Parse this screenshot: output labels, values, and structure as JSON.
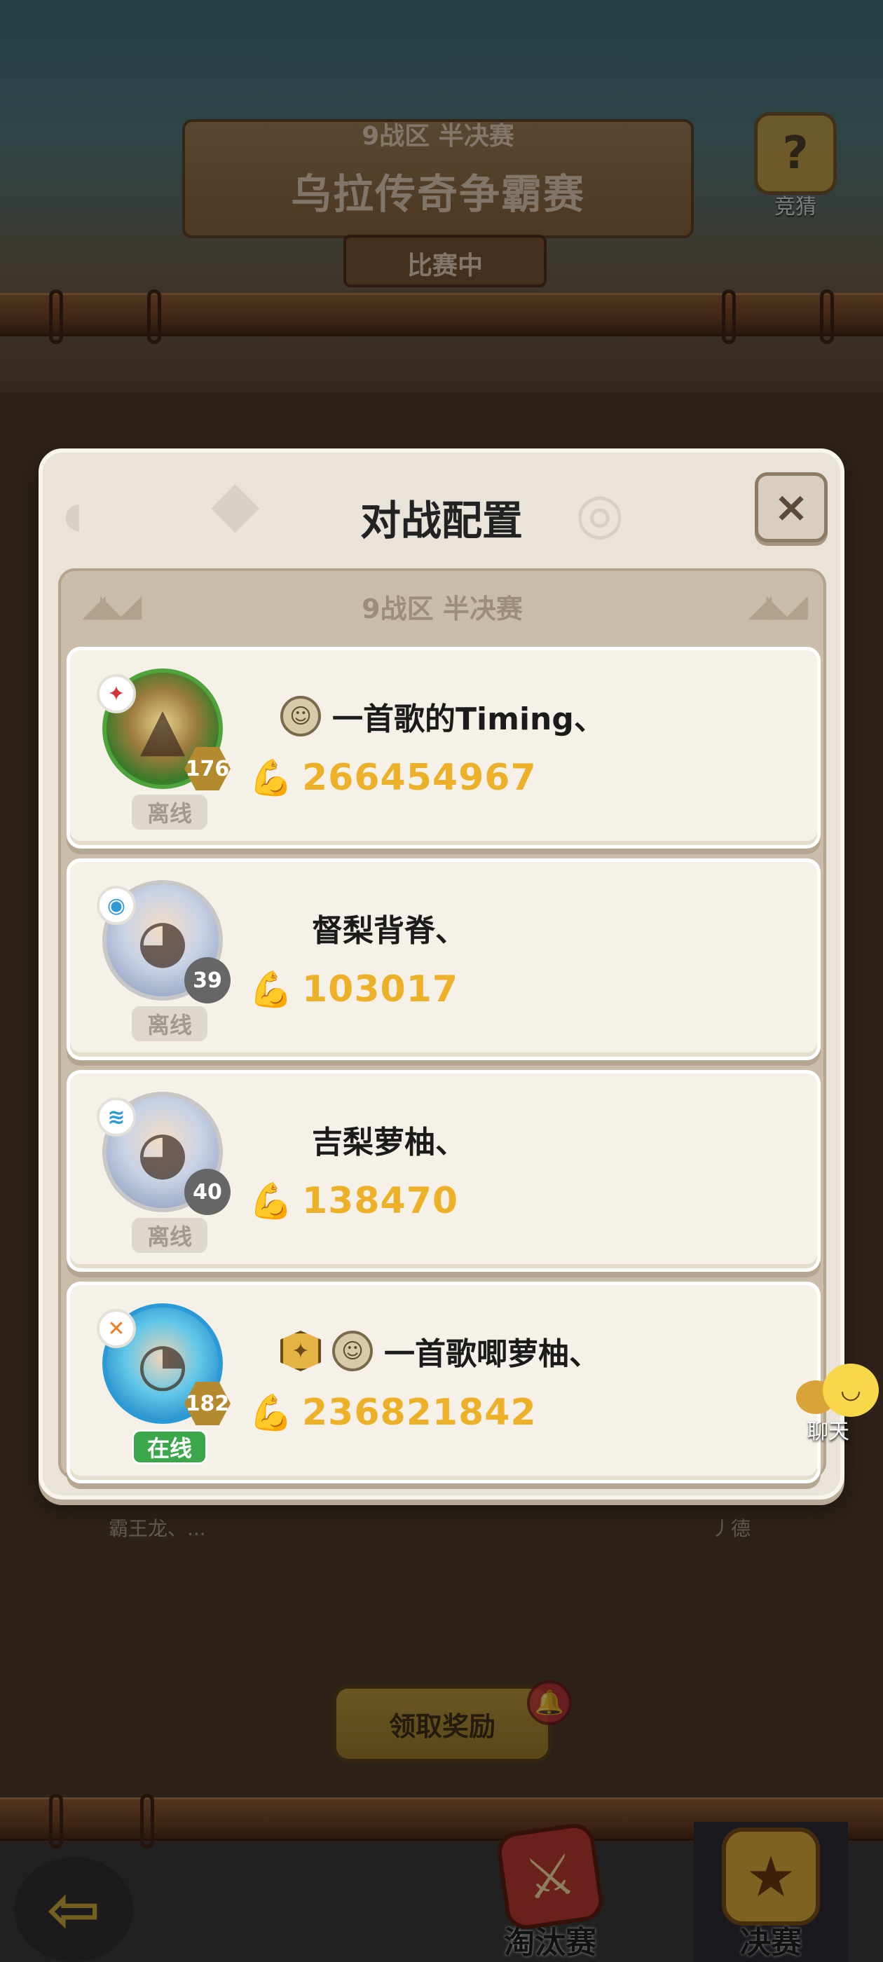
{
  "banner": {
    "subtitle": "9战区 半决赛",
    "title": "乌拉传奇争霸赛",
    "status": "比赛中",
    "guess_label": "竞猜"
  },
  "background": {
    "left_name": "霸王龙、...",
    "right_name": "丿德",
    "reward_button": "领取奖励"
  },
  "bottom_nav": {
    "tabs": [
      {
        "label": "淘汰赛"
      },
      {
        "label": "决赛"
      }
    ]
  },
  "modal": {
    "title": "对战配置",
    "close_symbol": "×",
    "section_header": "9战区 半决赛",
    "players": [
      {
        "name": "一首歌的Timing、",
        "power": "266454967",
        "level": "176",
        "status": "离线"
      },
      {
        "name": "督梨背脊、",
        "power": "103017",
        "level": "39",
        "status": "离线"
      },
      {
        "name": "吉梨萝柚、",
        "power": "138470",
        "level": "40",
        "status": "离线"
      },
      {
        "name": "一首歌唧萝柚、",
        "power": "236821842",
        "level": "182",
        "status": "在线"
      }
    ]
  },
  "chat": {
    "label": "聊天"
  },
  "colors": {
    "power_text": "#ecb128",
    "online_badge": "#3aa84a",
    "offline_badge": "#ddd7ce",
    "modal_bg": "#e9e3d9"
  }
}
